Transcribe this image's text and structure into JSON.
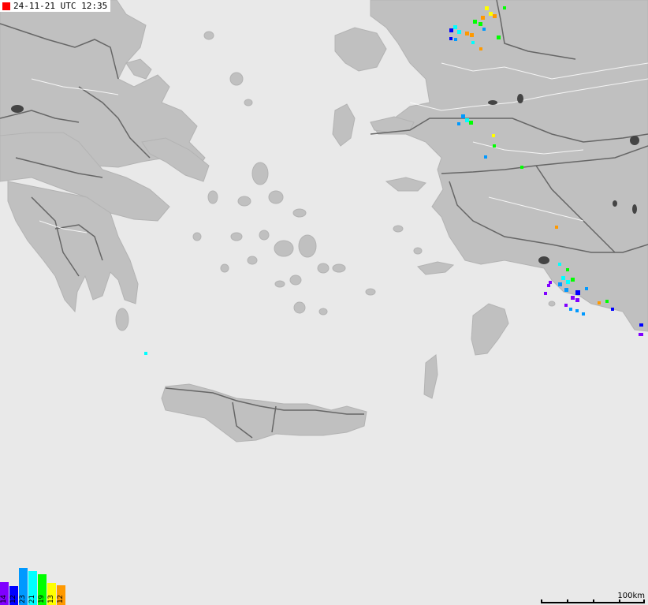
{
  "header": {
    "timestamp": "24-11-21 UTC 12:35",
    "indicator_color": "#ff0000"
  },
  "legend": {
    "items": [
      {
        "label": "14",
        "color": "#8000ff"
      },
      {
        "label": "12",
        "color": "#0000ff"
      },
      {
        "label": "23",
        "color": "#0099ff"
      },
      {
        "label": "21",
        "color": "#00ffff"
      },
      {
        "label": "19",
        "color": "#00ff00"
      },
      {
        "label": "13",
        "color": "#ffff00"
      },
      {
        "label": "12",
        "color": "#ff9900"
      }
    ]
  },
  "scale": {
    "label": "100km"
  },
  "colors": {
    "sea": "#e9e9e9",
    "land": "#c0c0c0",
    "border": "#666666",
    "road": "#ffffff",
    "lake": "#444444"
  }
}
